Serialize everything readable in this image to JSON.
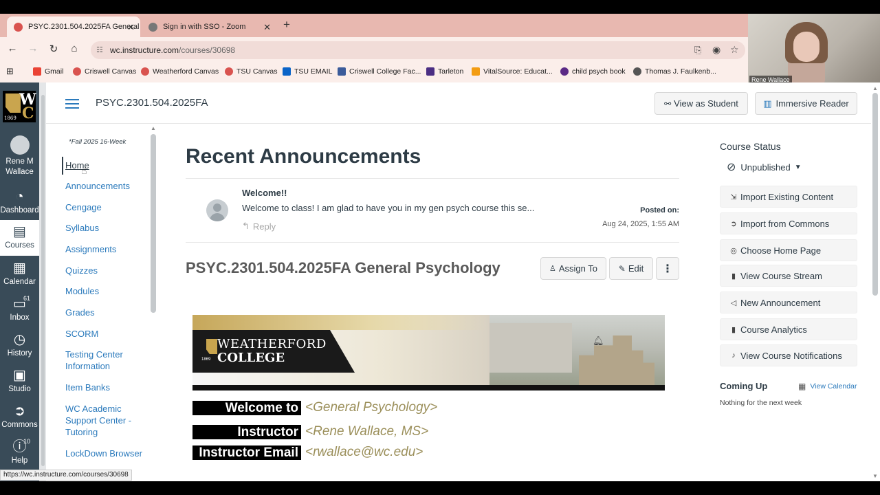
{
  "browser": {
    "tabs": [
      {
        "title": "PSYC.2301.504.2025FA General",
        "active": true
      },
      {
        "title": "Sign in with SSO - Zoom",
        "active": false
      }
    ],
    "url_domain": "wc.instructure.com",
    "url_path": "/courses/30698",
    "bookmarks": [
      "Gmail",
      "Criswell Canvas",
      "Weatherford Canvas",
      "TSU Canvas",
      "TSU EMAIL",
      "Criswell College Fac...",
      "Tarleton",
      "VitalSource: Educat...",
      "child psych book",
      "Thomas J. Faulkenb..."
    ],
    "status_url": "https://wc.instructure.com/courses/30698"
  },
  "webcam": {
    "name": "Rene Wallace"
  },
  "global_nav": {
    "logo_top": "W",
    "logo_bottom": "C",
    "logo_year": "1869",
    "items": [
      {
        "label": "Rene M Wallace",
        "icon": "avatar-icon"
      },
      {
        "label": "Dashboard",
        "icon": "dashboard-icon"
      },
      {
        "label": "Courses",
        "icon": "courses-icon"
      },
      {
        "label": "Calendar",
        "icon": "calendar-icon"
      },
      {
        "label": "Inbox",
        "icon": "inbox-icon",
        "badge": "61"
      },
      {
        "label": "History",
        "icon": "history-icon"
      },
      {
        "label": "Studio",
        "icon": "studio-icon"
      },
      {
        "label": "Commons",
        "icon": "commons-icon"
      },
      {
        "label": "Help",
        "icon": "help-icon",
        "badge": "10"
      }
    ]
  },
  "course": {
    "code": "PSYC.2301.504.2025FA",
    "view_as_student": "View as Student",
    "immersive_reader": "Immersive Reader",
    "term": "*Fall 2025 16-Week",
    "nav": [
      "Home",
      "Announcements",
      "Cengage",
      "Syllabus",
      "Assignments",
      "Quizzes",
      "Modules",
      "Grades",
      "SCORM",
      "Testing Center Information",
      "Item Banks",
      "WC Academic Support Center - Tutoring",
      "LockDown Browser"
    ]
  },
  "main": {
    "announcements_title": "Recent Announcements",
    "announcement": {
      "title": "Welcome!!",
      "body": "Welcome to class! I am glad to have you in my gen psych course this se...",
      "reply": "Reply",
      "posted_label": "Posted on:",
      "posted_date": "Aug 24, 2025, 1:55 AM"
    },
    "page_title": "PSYC.2301.504.2025FA General Psychology",
    "assign_to": "Assign To",
    "edit": "Edit",
    "banner_line1": "WEATHERFORD",
    "banner_line2": "COLLEGE",
    "banner_year": "1869",
    "welcome_rows": [
      {
        "label": "Welcome to",
        "value": "<General Psychology>"
      },
      {
        "label": "Instructor",
        "value": "<Rene Wallace, MS>"
      },
      {
        "label": "Instructor Email",
        "value": "<rwallace@wc.edu>"
      }
    ]
  },
  "sidebar": {
    "status_title": "Course Status",
    "status_value": "Unpublished",
    "actions": [
      "Import Existing Content",
      "Import from Commons",
      "Choose Home Page",
      "View Course Stream",
      "New Announcement",
      "Course Analytics",
      "View Course Notifications"
    ],
    "coming_up": "Coming Up",
    "view_calendar": "View Calendar",
    "nothing": "Nothing for the next week"
  },
  "colors": {
    "canvas_nav": "#394b58",
    "link": "#2b7abc",
    "tab_bar": "#e8b8b0",
    "brand_gold": "#9b8f5a"
  }
}
